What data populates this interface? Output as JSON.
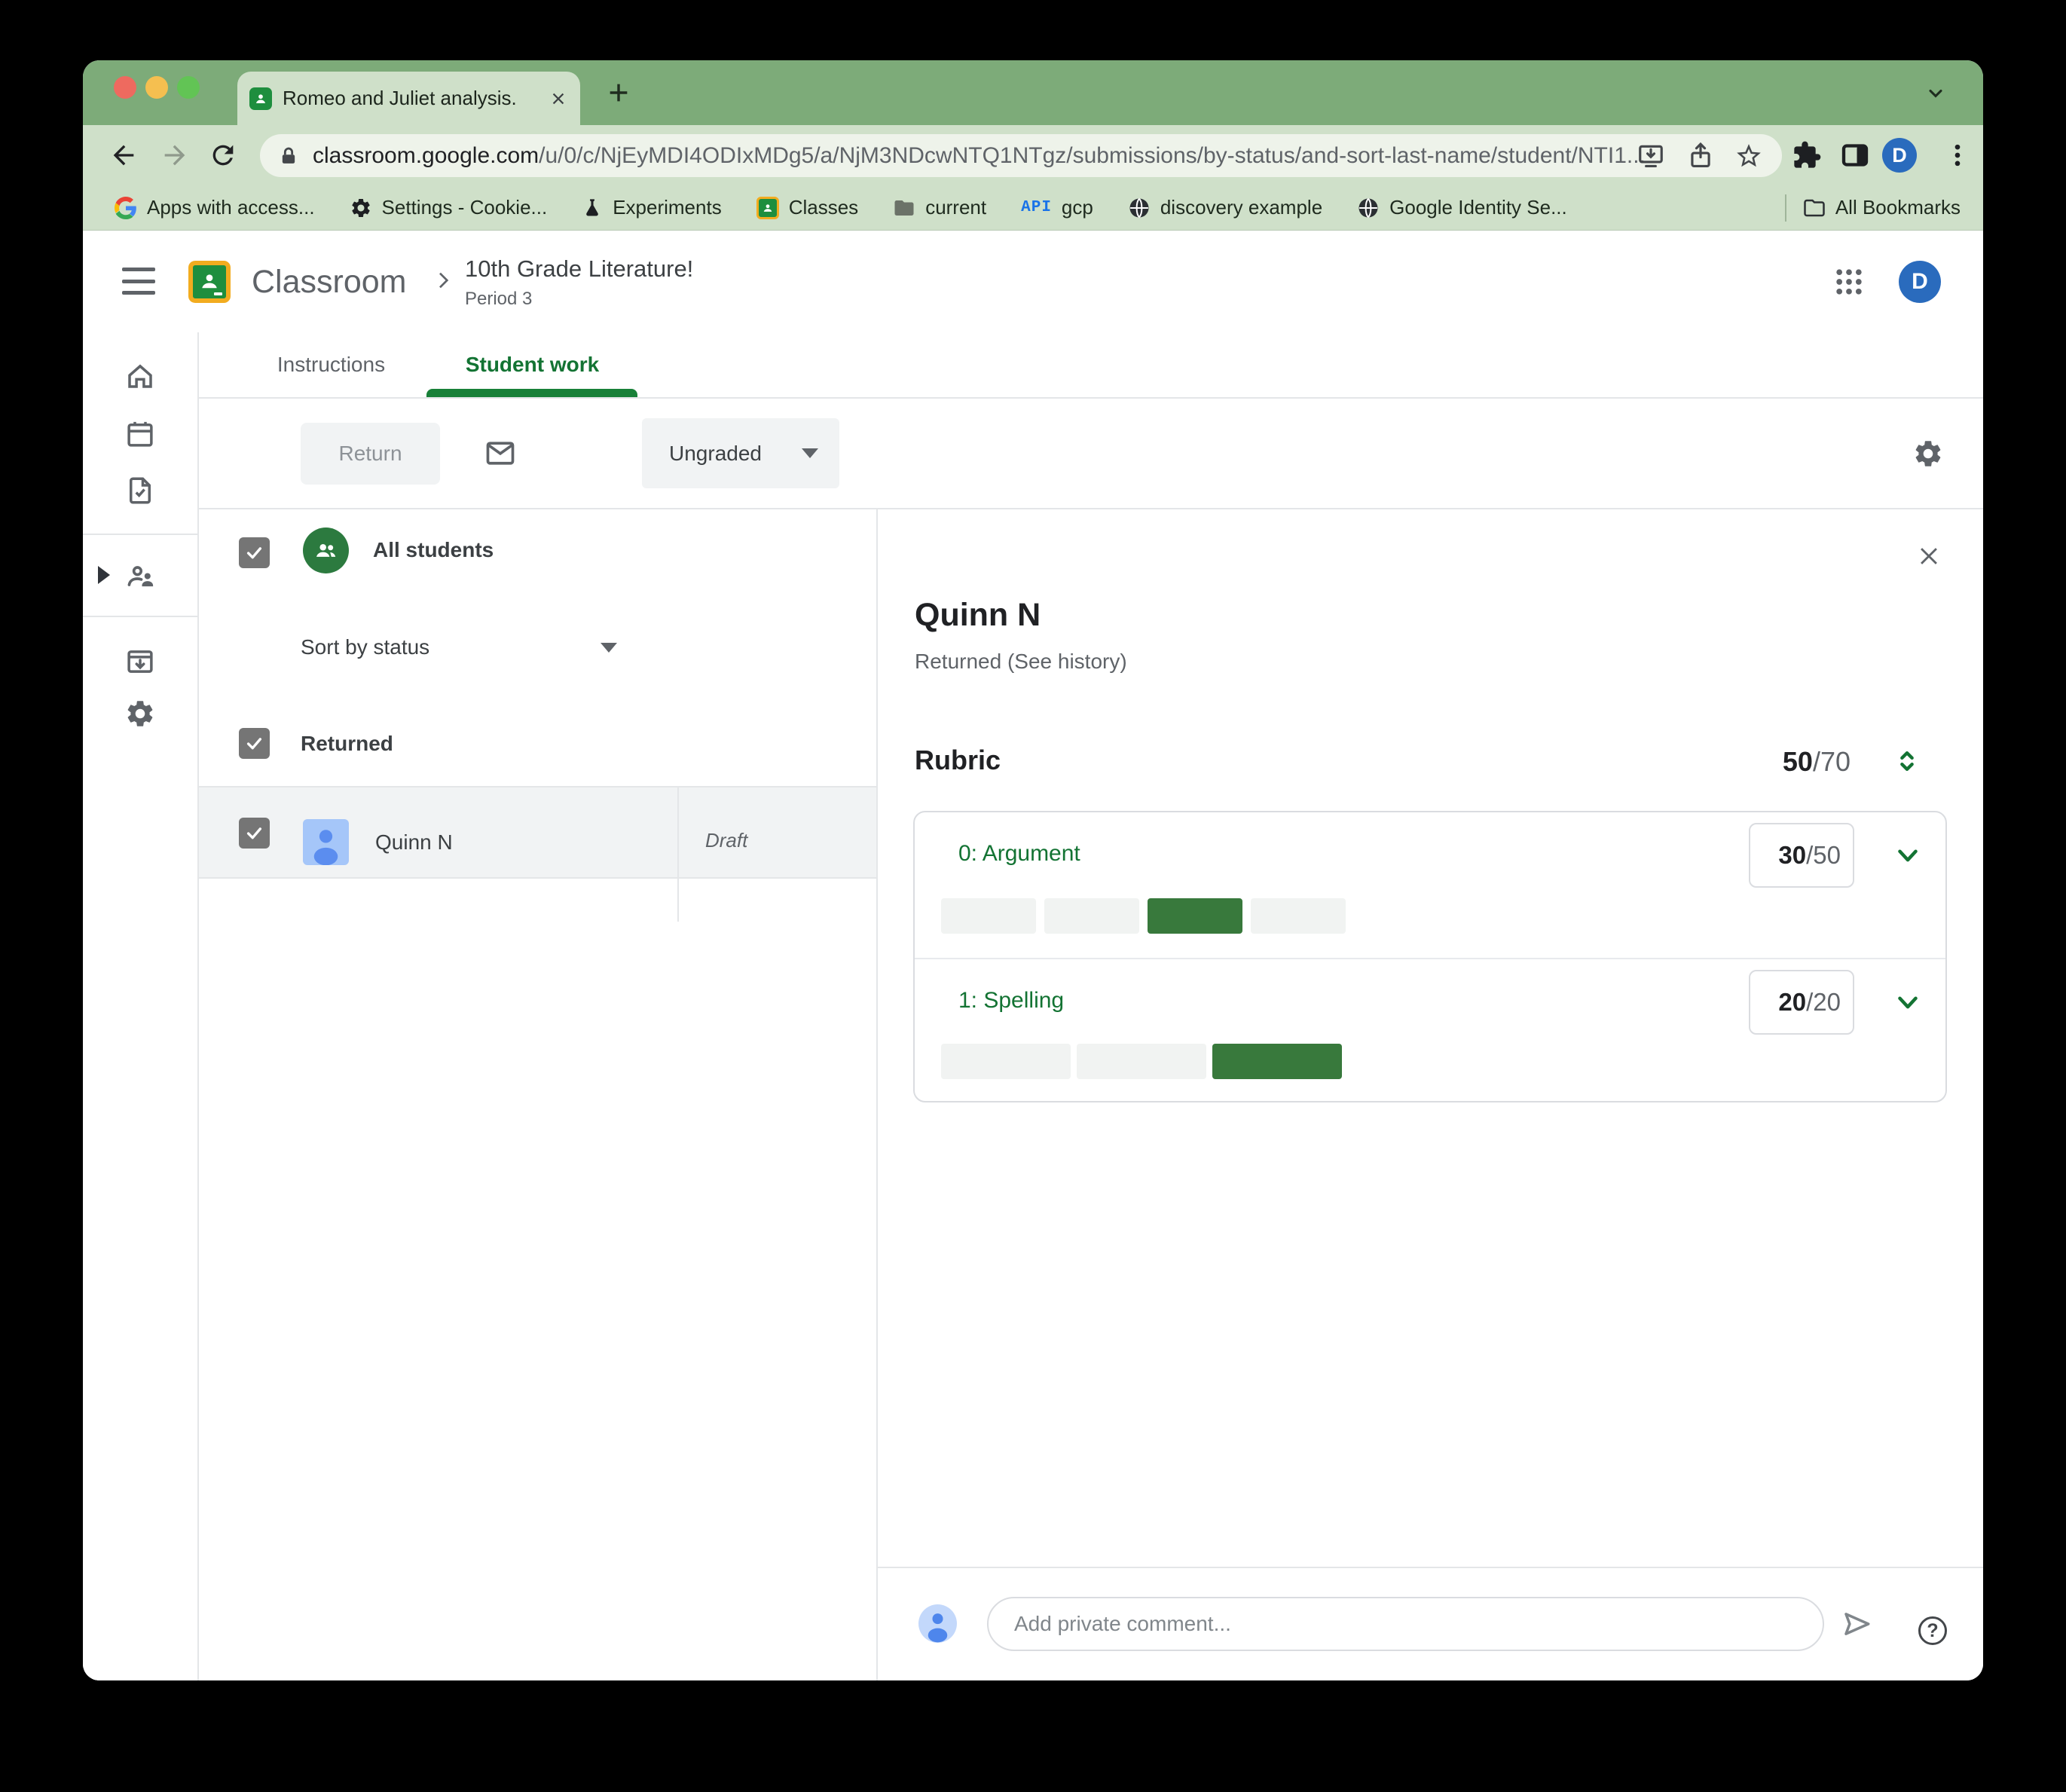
{
  "browser": {
    "tab": {
      "title": "Romeo and Juliet analysis."
    },
    "address": {
      "domain": "classroom.google.com",
      "path": "/u/0/c/NjEyMDI4ODIxMDg5/a/NjM3NDcwNTQ1NTgz/submissions/by-status/and-sort-last-name/student/NTI1..."
    },
    "profile_initial": "D",
    "bookmarks_bar": {
      "items": [
        {
          "icon": "google-g-icon",
          "label": "Apps with access..."
        },
        {
          "icon": "gear-icon",
          "label": "Settings - Cookie..."
        },
        {
          "icon": "flask-icon",
          "label": "Experiments"
        },
        {
          "icon": "classroom-icon",
          "label": "Classes"
        },
        {
          "icon": "folder-icon",
          "label": "current"
        },
        {
          "icon": "api-icon",
          "label": "gcp"
        },
        {
          "icon": "globe-icon",
          "label": "discovery example"
        },
        {
          "icon": "globe-icon",
          "label": "Google Identity Se..."
        }
      ],
      "api_icon_text": "API",
      "all_bookmarks_label": "All Bookmarks"
    }
  },
  "app": {
    "header": {
      "product_name": "Classroom",
      "course_title": "10th Grade Literature!",
      "course_period": "Period 3",
      "profile_initial": "D"
    },
    "tabs": [
      {
        "label": "Instructions",
        "active": false
      },
      {
        "label": "Student work",
        "active": true
      }
    ],
    "action_bar": {
      "return_label": "Return",
      "grade_filter_value": "Ungraded"
    },
    "student_list": {
      "select_all_label": "All students",
      "sort_value": "Sort by status",
      "status_group_label": "Returned",
      "rows": [
        {
          "name": "Quinn N",
          "work_status": "Draft",
          "selected": true
        }
      ]
    },
    "detail_panel": {
      "student_name": "Quinn N",
      "submission_status": "Returned (See history)",
      "rubric": {
        "label": "Rubric",
        "score": "50",
        "max": "/70",
        "criteria": [
          {
            "title": "0: Argument",
            "score": "30",
            "max": "/50",
            "levels": 4,
            "selected_level_index": 2
          },
          {
            "title": "1: Spelling",
            "score": "20",
            "max": "/20",
            "levels": 3,
            "selected_level_index": 2
          }
        ]
      },
      "comment_placeholder": "Add private comment...",
      "help_glyph": "?"
    }
  },
  "colors": {
    "frame_green": "#7dab79",
    "toolbar_green": "#cfe0c9",
    "urlbar_bg": "#eef3ea",
    "classroom_green": "#1e8e3e",
    "accent_green_text": "#137333",
    "tab_underline_green": "#188038",
    "rubric_fill_green": "#38793c",
    "profile_blue": "#2a6bbd",
    "selected_row_gray": "#f1f3f4"
  }
}
